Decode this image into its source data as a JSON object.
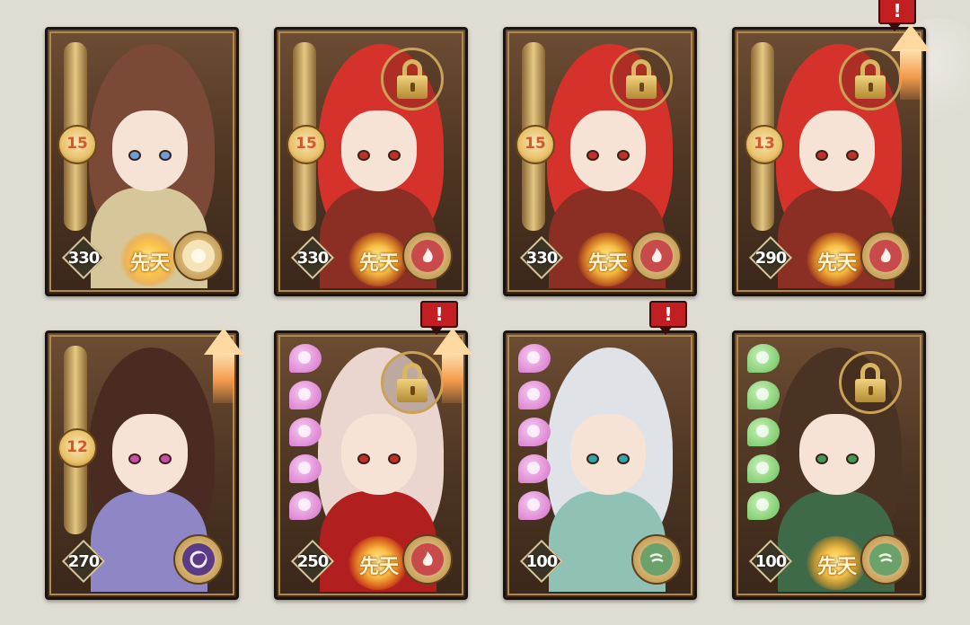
{
  "innate_label": "先天",
  "alert_symbol": "!",
  "cards": [
    {
      "power": "330",
      "level": "15",
      "element": "light",
      "element_color": "#f6e4b8",
      "locked": false,
      "upgrade": false,
      "alert": false,
      "hair": "#7a4a36",
      "eyes": "#6b9ed8",
      "cloth": "#d7c69a",
      "innate": true
    },
    {
      "power": "330",
      "level": "15",
      "element": "fire",
      "element_color": "#c94a4a",
      "locked": true,
      "upgrade": false,
      "alert": false,
      "hair": "#d5322b",
      "eyes": "#c0302a",
      "cloth": "#8b2f24",
      "innate": true
    },
    {
      "power": "330",
      "level": "15",
      "element": "fire",
      "element_color": "#c94a4a",
      "locked": true,
      "upgrade": false,
      "alert": false,
      "hair": "#d5322b",
      "eyes": "#c0302a",
      "cloth": "#8b2f24",
      "innate": true
    },
    {
      "power": "290",
      "level": "13",
      "element": "fire",
      "element_color": "#c94a4a",
      "locked": true,
      "upgrade": true,
      "alert": true,
      "hair": "#d5322b",
      "eyes": "#c0302a",
      "cloth": "#8b2f24",
      "innate": true
    },
    {
      "power": "270",
      "level": "12",
      "element": "dark",
      "element_color": "#5a3b86",
      "locked": false,
      "upgrade": true,
      "alert": false,
      "hair": "#4a2b22",
      "eyes": "#c84fa8",
      "cloth": "#8f86c6",
      "innate": false
    },
    {
      "power": "250",
      "level": "",
      "element": "fire",
      "element_color": "#c94a4a",
      "locked": true,
      "upgrade": true,
      "alert": true,
      "hair": "#ead6cf",
      "eyes": "#c0302a",
      "cloth": "#b11f1f",
      "innate": true,
      "pearls": "pink"
    },
    {
      "power": "100",
      "level": "",
      "element": "wind",
      "element_color": "#6aa26a",
      "locked": false,
      "upgrade": false,
      "alert": true,
      "hair": "#dfe3e8",
      "eyes": "#2fa7a7",
      "cloth": "#8fc1b5",
      "innate": false,
      "pearls": "pink"
    },
    {
      "power": "100",
      "level": "",
      "element": "wind",
      "element_color": "#6aa26a",
      "locked": true,
      "upgrade": false,
      "alert": false,
      "hair": "#4b3323",
      "eyes": "#3e9a52",
      "cloth": "#3f6a4a",
      "innate": true,
      "pearls": "green"
    }
  ]
}
